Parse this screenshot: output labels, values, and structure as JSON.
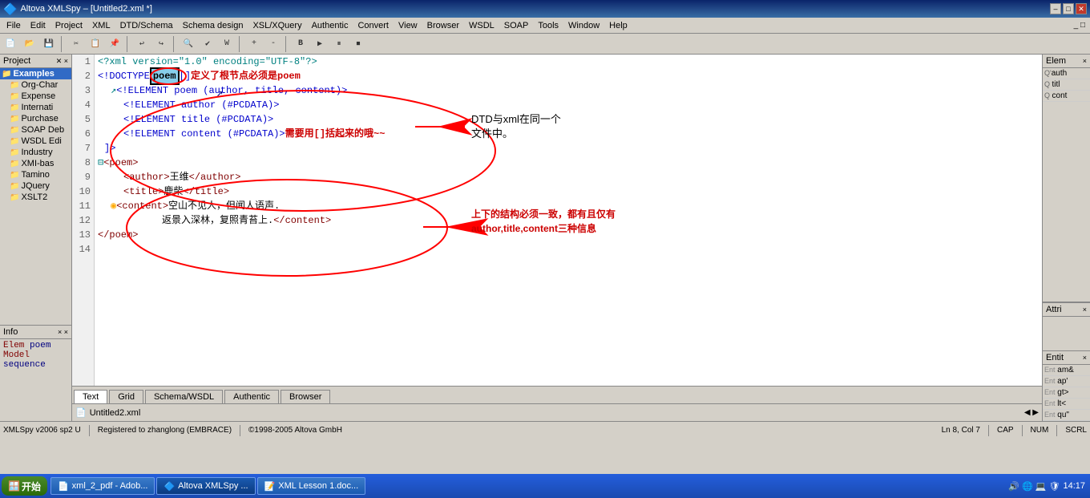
{
  "titlebar": {
    "title": "Altova XMLSpy – [Untitled2.xml *]",
    "min_btn": "–",
    "max_btn": "□",
    "close_btn": "✕"
  },
  "menubar": {
    "items": [
      "File",
      "Edit",
      "Project",
      "XML",
      "DTD/Schema",
      "Schema design",
      "XSL/XQuery",
      "Authentic",
      "Convert",
      "View",
      "Browser",
      "WSDL",
      "SOAP",
      "Tools",
      "Window",
      "Help"
    ]
  },
  "project_panel": {
    "title": "Project",
    "items": [
      {
        "label": "Examples",
        "type": "folder",
        "selected": true
      },
      {
        "label": "Org-Char",
        "type": "folder"
      },
      {
        "label": "Expense",
        "type": "folder"
      },
      {
        "label": "Internati",
        "type": "folder"
      },
      {
        "label": "Purchase",
        "type": "folder"
      },
      {
        "label": "SOAP Deb",
        "type": "folder"
      },
      {
        "label": "WSDL Edi",
        "type": "folder"
      },
      {
        "label": "Industry",
        "type": "folder"
      },
      {
        "label": "XMI-bas",
        "type": "folder"
      },
      {
        "label": "Tamino",
        "type": "folder"
      },
      {
        "label": "JQuery",
        "type": "folder"
      },
      {
        "label": "XSLT2",
        "type": "folder"
      }
    ]
  },
  "editor": {
    "lines": [
      {
        "num": 1,
        "content": "<?xml version=\"1.0\" encoding=\"UTF-8\"?>"
      },
      {
        "num": 2,
        "content": "<!DOCTYPE poem [] 定义了根节点必须是poem"
      },
      {
        "num": 3,
        "content": "    <!ELEMENT poem (author, title, content)>"
      },
      {
        "num": 4,
        "content": "    <!ELEMENT author (#PCDATA)>"
      },
      {
        "num": 5,
        "content": "    <!ELEMENT title (#PCDATA)>"
      },
      {
        "num": 6,
        "content": "    <!ELEMENT content (#PCDATA)> 需要用[]括起来的哦~~"
      },
      {
        "num": 7,
        "content": "]>"
      },
      {
        "num": 8,
        "content": "<poem>"
      },
      {
        "num": 9,
        "content": "    <author>王维</author>"
      },
      {
        "num": 10,
        "content": "    <title>鹿柴</title>"
      },
      {
        "num": 11,
        "content": "    <content>空山不见人，但闻人语声."
      },
      {
        "num": 12,
        "content": "            返景入深林，复照青苔上.</content>"
      },
      {
        "num": 13,
        "content": "</poem>"
      },
      {
        "num": 14,
        "content": ""
      }
    ]
  },
  "annotations": {
    "dtd_note": "DTD与xml在同一个\n文件中。",
    "struct_note": "上下的结构必须一致，都有且仅有\nauthor,title,content三种信息",
    "bracket_note": "定义了根节点必须是poem",
    "bracket_note2": "需要用[]括起来的哦~~"
  },
  "right_panel": {
    "elem_title": "Elem",
    "elem_items": [
      "auth",
      "titl",
      "cont"
    ],
    "attr_title": "Attri",
    "entit_title": "Entit",
    "entit_items": [
      {
        "prefix": "Ent",
        "name": "am",
        "val": "&"
      },
      {
        "prefix": "Ent",
        "name": "ap",
        "val": "'"
      },
      {
        "prefix": "Ent",
        "name": "gt",
        "val": ">"
      },
      {
        "prefix": "Ent",
        "name": "lt",
        "val": "<"
      },
      {
        "prefix": "Ent",
        "name": "qu",
        "val": "\""
      }
    ]
  },
  "bottom_tabs": [
    "Text",
    "Grid",
    "Schema/WSDL",
    "Authentic",
    "Browser"
  ],
  "active_tab": "Text",
  "status_bar": {
    "app": "XMLSpy v2006 sp2 U",
    "reg": "Registered to zhanglong (EMBRACE)",
    "copy": "©1998-2005 Altova GmbH",
    "pos": "Ln 8, Col 7",
    "caps": "CAP",
    "num": "NUM",
    "scrl": "SCRL"
  },
  "filename_bar": "Untitled2.xml",
  "info_panel": {
    "title": "Info",
    "elem_label": "Elem",
    "elem_value": "poem",
    "model_label": "Model",
    "model_value": "sequence"
  },
  "taskbar": {
    "start_label": "开始",
    "items": [
      {
        "label": "xml_2_pdf - Adob...",
        "icon": "📄"
      },
      {
        "label": "Altova XMLSpy ...",
        "icon": "🔷",
        "active": true
      },
      {
        "label": "XML Lesson 1.doc...",
        "icon": "📝"
      }
    ],
    "time": "14:17"
  }
}
